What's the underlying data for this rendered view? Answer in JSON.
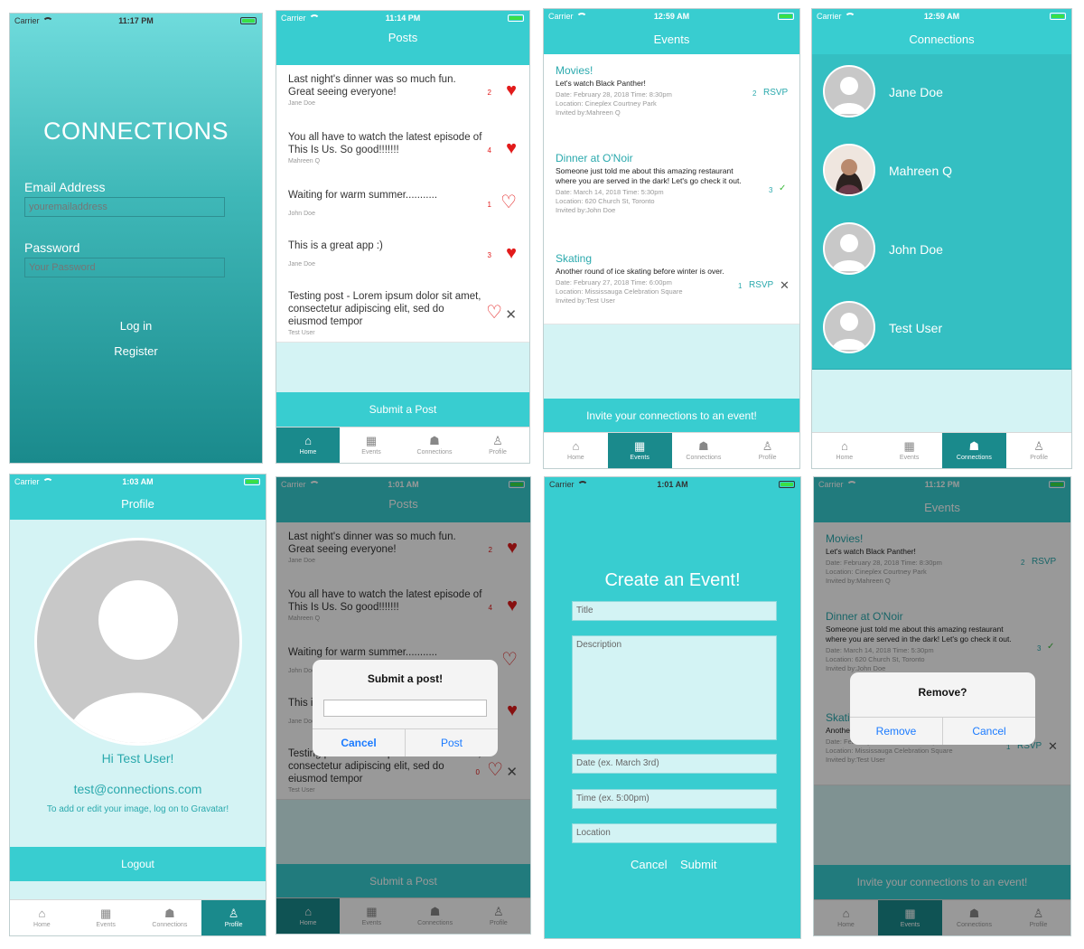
{
  "status": {
    "carrier": "Carrier"
  },
  "login": {
    "time": "11:17 PM",
    "title": "CONNECTIONS",
    "email_label": "Email Address",
    "email_placeholder": "youremailaddress",
    "password_label": "Password",
    "password_placeholder": "Your Password",
    "login_label": "Log in",
    "register_label": "Register"
  },
  "tabs": [
    {
      "label": "Home",
      "icon": "home-icon"
    },
    {
      "label": "Events",
      "icon": "calendar-icon"
    },
    {
      "label": "Connections",
      "icon": "people-icon"
    },
    {
      "label": "Profile",
      "icon": "person-icon"
    }
  ],
  "posts_screen": {
    "time": "11:14 PM",
    "title": "Posts",
    "submit_label": "Submit a Post",
    "posts": [
      {
        "text": "Last night's dinner was so much fun. Great seeing everyone!",
        "author": "Jane Doe",
        "likes": "2",
        "liked": true
      },
      {
        "text": "You all have to watch the latest episode of This Is Us. So good!!!!!!!",
        "author": "Mahreen Q",
        "likes": "4",
        "liked": true
      },
      {
        "text": "Waiting for warm summer...........",
        "author": "John Doe",
        "likes": "1",
        "liked": false
      },
      {
        "text": "This is a great app :)",
        "author": "Jane Doe",
        "likes": "3",
        "liked": true
      },
      {
        "text": "Testing post - Lorem ipsum dolor sit amet, consectetur adipiscing elit, sed do eiusmod tempor",
        "author": "Test User",
        "likes": "",
        "liked": false
      }
    ]
  },
  "events_screen": {
    "time": "12:59 AM",
    "title": "Events",
    "invite_label": "Invite your connections to an event!",
    "events": [
      {
        "title": "Movies!",
        "desc": "Let's watch Black Panther!",
        "date": "Date: February 28, 2018  Time: 8:30pm",
        "location": "Location: Cineplex Courtney Park",
        "invited": "Invited by:Mahreen Q",
        "count": "2",
        "action": "RSVP"
      },
      {
        "title": "Dinner at O'Noir",
        "desc": "Someone just told me about this amazing restaurant where you are served in the dark! Let's go check it out.",
        "date": "Date: March 14, 2018  Time: 5:30pm",
        "location": "Location: 620 Church St, Toronto",
        "invited": "Invited by:John Doe",
        "count": "3",
        "action": "✓"
      },
      {
        "title": "Skating",
        "desc": "Another round of ice skating before winter is over.",
        "date": "Date: February 27, 2018  Time: 6:00pm",
        "location": "Location: Mississauga Celebration Square",
        "invited": "Invited by:Test User",
        "count": "1",
        "action": "RSVP"
      }
    ]
  },
  "connections_screen": {
    "time": "12:59 AM",
    "title": "Connections",
    "people": [
      "Jane Doe",
      "Mahreen Q",
      "John Doe",
      "Test User"
    ]
  },
  "profile_screen": {
    "time": "1:03 AM",
    "title": "Profile",
    "greeting": "Hi Test User!",
    "email": "test@connections.com",
    "hint": "To add or edit your image, log on to Gravatar!",
    "logout_label": "Logout"
  },
  "submit_dialog": {
    "time": "1:01 AM",
    "title": "Submit a post!",
    "cancel": "Cancel",
    "post": "Post",
    "last_count": "0"
  },
  "create_event": {
    "time": "1:01 AM",
    "heading": "Create an Event!",
    "title_ph": "Title",
    "desc_ph": "Description",
    "date_ph": "Date (ex. March 3rd)",
    "time_ph": "Time (ex. 5:00pm)",
    "location_ph": "Location",
    "cancel": "Cancel",
    "submit": "Submit"
  },
  "remove_dialog": {
    "time": "11:12 PM",
    "title": "Remove?",
    "remove": "Remove",
    "cancel": "Cancel"
  },
  "colors": {
    "teal": "#38cdd0",
    "dark_teal": "#1a8a8c",
    "light_teal": "#d4f3f4",
    "heart": "#e21b1b"
  }
}
